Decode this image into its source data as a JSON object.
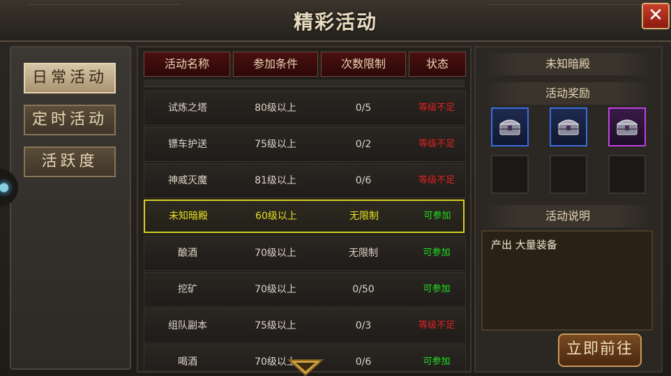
{
  "window": {
    "title": "精彩活动"
  },
  "sidebar": {
    "tabs": [
      "日常活动",
      "定时活动",
      "活跃度"
    ]
  },
  "table": {
    "headers": [
      "活动名称",
      "参加条件",
      "次数限制",
      "状态"
    ],
    "rows": [
      {
        "name": "试炼之塔",
        "level": "80级以上",
        "limit": "0/5",
        "status": "等级不足",
        "selected": false
      },
      {
        "name": "镖车护送",
        "level": "75级以上",
        "limit": "0/2",
        "status": "等级不足",
        "selected": false
      },
      {
        "name": "神威灭魔",
        "level": "81级以上",
        "limit": "0/6",
        "status": "等级不足",
        "selected": false
      },
      {
        "name": "未知暗殿",
        "level": "60级以上",
        "limit": "无限制",
        "status": "可参加",
        "selected": true
      },
      {
        "name": "酿酒",
        "level": "70级以上",
        "limit": "无限制",
        "status": "可参加",
        "selected": false
      },
      {
        "name": "挖矿",
        "level": "70级以上",
        "limit": "0/50",
        "status": "可参加",
        "selected": false
      },
      {
        "name": "组队副本",
        "level": "75级以上",
        "limit": "0/3",
        "status": "等级不足",
        "selected": false
      },
      {
        "name": "喝酒",
        "level": "70级以上",
        "limit": "0/6",
        "status": "可参加",
        "selected": false
      }
    ]
  },
  "detail": {
    "activity_name": "未知暗殿",
    "rewards_title": "活动奖励",
    "desc_title": "活动说明",
    "description": "产出 大量装备",
    "go_button": "立即前往",
    "reward_slots": [
      {
        "icon": "chest-icon",
        "rarity": "blue"
      },
      {
        "icon": "chest-icon",
        "rarity": "blue"
      },
      {
        "icon": "chest-icon",
        "rarity": "purple"
      },
      {
        "icon": "",
        "rarity": "empty"
      },
      {
        "icon": "",
        "rarity": "empty"
      },
      {
        "icon": "",
        "rarity": "empty"
      }
    ]
  },
  "colors": {
    "available": "#20e020",
    "insufficient": "#e02020",
    "selected_text": "#e8e020",
    "selected_border": "#d8d020"
  }
}
